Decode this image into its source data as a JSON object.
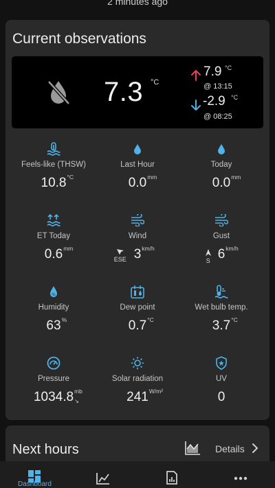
{
  "header": {
    "updated": "2 minutes ago"
  },
  "observations": {
    "title": "Current observations",
    "hero": {
      "temperature": "7.3",
      "unit": "°C",
      "high": {
        "value": "7.9",
        "unit": "°C",
        "time": "@ 13:15"
      },
      "low": {
        "value": "-2.9",
        "unit": "°C",
        "time": "@ 08:25"
      }
    },
    "metrics": [
      {
        "label": "Feels-like (THSW)",
        "value": "10.8",
        "unit": "°C",
        "icon": "feels-like-icon"
      },
      {
        "label": "Last Hour",
        "value": "0.0",
        "unit": "mm",
        "icon": "rain-drop-icon"
      },
      {
        "label": "Today",
        "value": "0.0",
        "unit": "mm",
        "icon": "rain-drop-icon"
      },
      {
        "label": "ET Today",
        "value": "0.6",
        "unit": "mm",
        "icon": "evapotranspiration-icon"
      },
      {
        "label": "Wind",
        "value": "3",
        "unit": "km/h",
        "dir": "ESE",
        "icon": "wind-icon"
      },
      {
        "label": "Gust",
        "value": "6",
        "unit": "km/h",
        "dir": "S",
        "icon": "gust-icon"
      },
      {
        "label": "Humidity",
        "value": "63",
        "unit": "%",
        "icon": "humidity-icon"
      },
      {
        "label": "Dew point",
        "value": "0.7",
        "unit": "°C",
        "icon": "dew-point-icon"
      },
      {
        "label": "Wet bulb temp.",
        "value": "3.7",
        "unit": "°C",
        "icon": "wet-bulb-icon"
      },
      {
        "label": "Pressure",
        "value": "1034.8",
        "unit": "mb",
        "trend": "↘",
        "icon": "pressure-gauge-icon"
      },
      {
        "label": "Solar radiation",
        "value": "241",
        "unit": "W/m²",
        "icon": "sun-icon"
      },
      {
        "label": "UV",
        "value": "0",
        "unit": "",
        "icon": "uv-shield-icon"
      }
    ]
  },
  "next_hours": {
    "title": "Next hours",
    "details": "Details"
  },
  "bottom_nav": {
    "active_label": "Dashboard"
  },
  "colors": {
    "accent": "#4fb3e8",
    "high": "#ef3d5a",
    "low": "#4fb3e8",
    "card": "#2a2a2a"
  }
}
